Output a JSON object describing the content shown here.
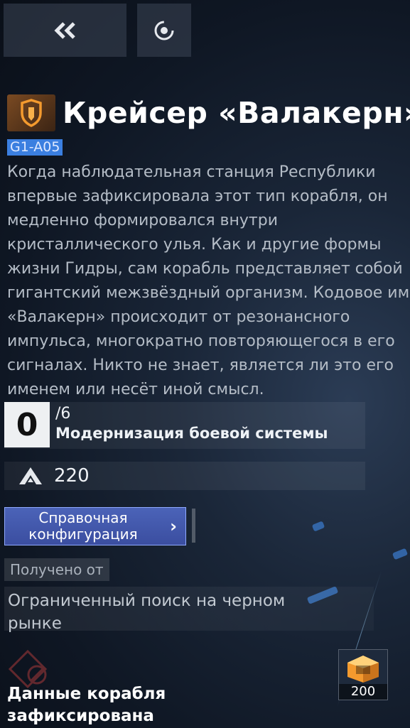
{
  "toolbar": {
    "back_icon": "double-chevron-left-icon",
    "focus_icon": "target-icon"
  },
  "ship": {
    "emblem_icon": "shield-emblem-icon",
    "title": "Крейсер «Валакерн»",
    "code": "G1-A05",
    "description": "Когда наблюдательная станция Республики\nвпервые зафиксировала этот тип корабля, он\nмедленно формировался внутри\nкристаллического улья. Как и другие формы\nжизни Гидры, сам корабль представляет собой\nгигантский межзвёздный организм. Кодовое имя\n«Валакерн» происходит от резонансного\nимпульса, многократно повторяющегося в его\nсигналах. Никто не знает, является ли это его\nименем или несёт иной смысл."
  },
  "upgrade": {
    "current": "0",
    "max": "/6",
    "label": "Модернизация боевой системы"
  },
  "power": {
    "icon": "power-rating-icon",
    "value": "220"
  },
  "config_button": {
    "label": "Справочная конфигурация",
    "arrow": "›"
  },
  "source": {
    "tag": "Получено от",
    "text": "Ограниченный поиск на черном рынке"
  },
  "ship_data": {
    "title": "Данные корабля\nзафиксирована",
    "emblem_icon": "faded-emblem-icon"
  },
  "reward": {
    "icon": "crystal-cube-icon",
    "quantity": "200"
  },
  "colors": {
    "accent_blue": "#3b7fe0",
    "button_blue": "#4b63b8",
    "emblem_orange": "#f39a2e"
  }
}
